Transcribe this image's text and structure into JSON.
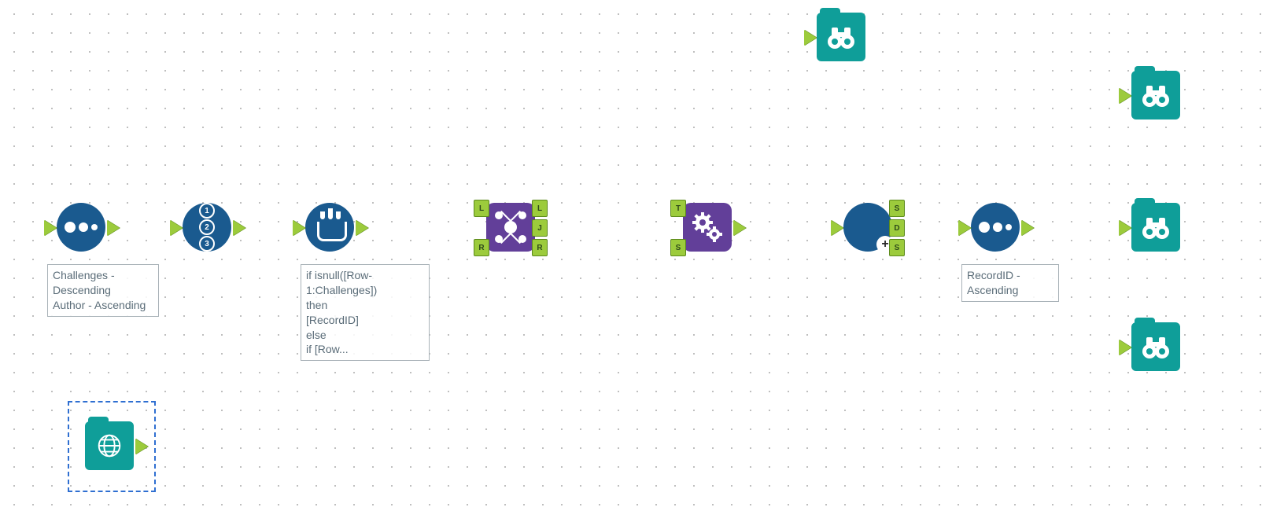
{
  "canvas": {
    "grid_spacing_px": 24
  },
  "colors": {
    "tool_blue": "#1a5a8f",
    "tool_purple": "#623f99",
    "tool_teal": "#0f9e99",
    "port_green": "#9ccb3c",
    "wire_default": "#6d6d6d",
    "wire_macro": "#2323c8",
    "selection": "#2f6fd1",
    "annot_text": "#5a6c78"
  },
  "nodes": {
    "sort1": {
      "type": "Sort",
      "icon": "sort-icon",
      "annotation": "Challenges - Descending\nAuthor - Ascending"
    },
    "recordid": {
      "type": "Record ID",
      "icon": "recordid-icon"
    },
    "multirow": {
      "type": "Multi-Row Formula",
      "icon": "multirow-icon",
      "annotation": "if isnull([Row-1:Challenges])\nthen\n[RecordID]\nelse\nif [Row..."
    },
    "join": {
      "type": "Join",
      "icon": "join-icon",
      "ports_in": [
        "L",
        "R"
      ],
      "ports_out": [
        "L",
        "J",
        "R"
      ]
    },
    "append": {
      "type": "Append Fields",
      "icon": "gears-icon",
      "ports_in": [
        "T",
        "S"
      ]
    },
    "unique": {
      "type": "Unique",
      "icon": "plus-icon",
      "ports_out": [
        "S",
        "D",
        "S"
      ]
    },
    "sort2": {
      "type": "Sort",
      "icon": "sort-icon",
      "annotation": "RecordID - Ascending"
    },
    "browse1": {
      "type": "Browse",
      "icon": "binoculars-icon"
    },
    "browse2": {
      "type": "Browse",
      "icon": "binoculars-icon"
    },
    "browse3": {
      "type": "Browse",
      "icon": "binoculars-icon"
    },
    "browse4": {
      "type": "Browse",
      "icon": "binoculars-icon"
    },
    "macroIn": {
      "type": "Macro Input",
      "icon": "globe-icon",
      "selected": true
    }
  },
  "connections": [
    {
      "from": "canvas-left",
      "to": "sort1"
    },
    {
      "from": "sort1",
      "to": "recordid"
    },
    {
      "from": "recordid",
      "to": "multirow"
    },
    {
      "from": "multirow",
      "to": "join",
      "to_port": "L"
    },
    {
      "from": "canvas-left-2",
      "to": "join",
      "to_port": "R"
    },
    {
      "from": "join",
      "from_port": "L",
      "to": "browse1"
    },
    {
      "from": "join",
      "from_port": "J",
      "to": "append",
      "to_port": "T"
    },
    {
      "from": "macroIn",
      "to": "append",
      "to_port": "S",
      "style": "macro"
    },
    {
      "from": "append",
      "to": "unique"
    },
    {
      "from": "unique",
      "from_port": "S",
      "to": "browse2"
    },
    {
      "from": "unique",
      "from_port": "D",
      "to": "sort2"
    },
    {
      "from": "unique",
      "from_port": "S",
      "to": "browse4"
    },
    {
      "from": "sort2",
      "to": "browse3"
    }
  ]
}
